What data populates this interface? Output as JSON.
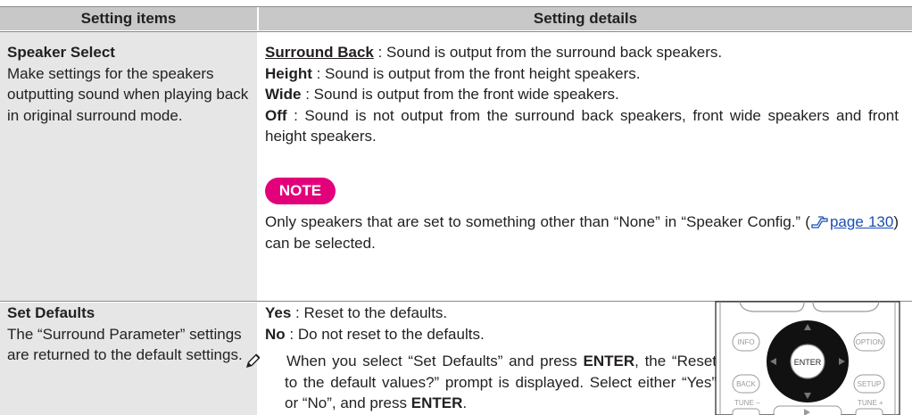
{
  "header": {
    "col1": "Setting items",
    "col2": "Setting details"
  },
  "rows": [
    {
      "item_title": "Speaker Select",
      "item_desc": "Make settings for the speakers outputting sound when playing back in original surround mode.",
      "details": [
        {
          "term": "Surround Back",
          "text": " : Sound is output from the surround back speakers."
        },
        {
          "term": "Height",
          "text": " : Sound is output from the front height speakers."
        },
        {
          "term": "Wide",
          "text": " : Sound is output from the front wide speakers."
        },
        {
          "term": "Off",
          "text": " : Sound is not output from the surround back speakers, front wide speakers and front height speakers."
        }
      ],
      "note_label": "NOTE",
      "note_text_before": "Only speakers that are set to something other than “None” in “Speaker Config.” (",
      "note_link": "page 130",
      "note_text_after": ") can be selected."
    },
    {
      "item_title": "Set Defaults",
      "item_desc": "The “Surround Parameter” settings are returned to the default settings.",
      "details": [
        {
          "term": "Yes",
          "text": " : Reset to the defaults."
        },
        {
          "term": "No",
          "text": " : Do not reset to the defaults."
        }
      ],
      "tip_part1": "When you select “Set Defaults” and press ",
      "tip_key1": "ENTER",
      "tip_part2": ", the “Reset to the default values?” prompt is displayed. Select either “Yes” or “No”, and press ",
      "tip_key2": "ENTER",
      "tip_part3": "."
    }
  ],
  "remote": {
    "center_label": "ENTER",
    "info": "INFO",
    "option": "OPTION",
    "back": "BACK",
    "setup": "SETUP",
    "tune_minus": "TUNE −",
    "tune_plus": "TUNE +"
  },
  "colors": {
    "header_bg": "#c8c8c8",
    "left_col_bg": "#e6e6e6",
    "note_pill": "#e3007b",
    "link": "#1a4fb5"
  }
}
